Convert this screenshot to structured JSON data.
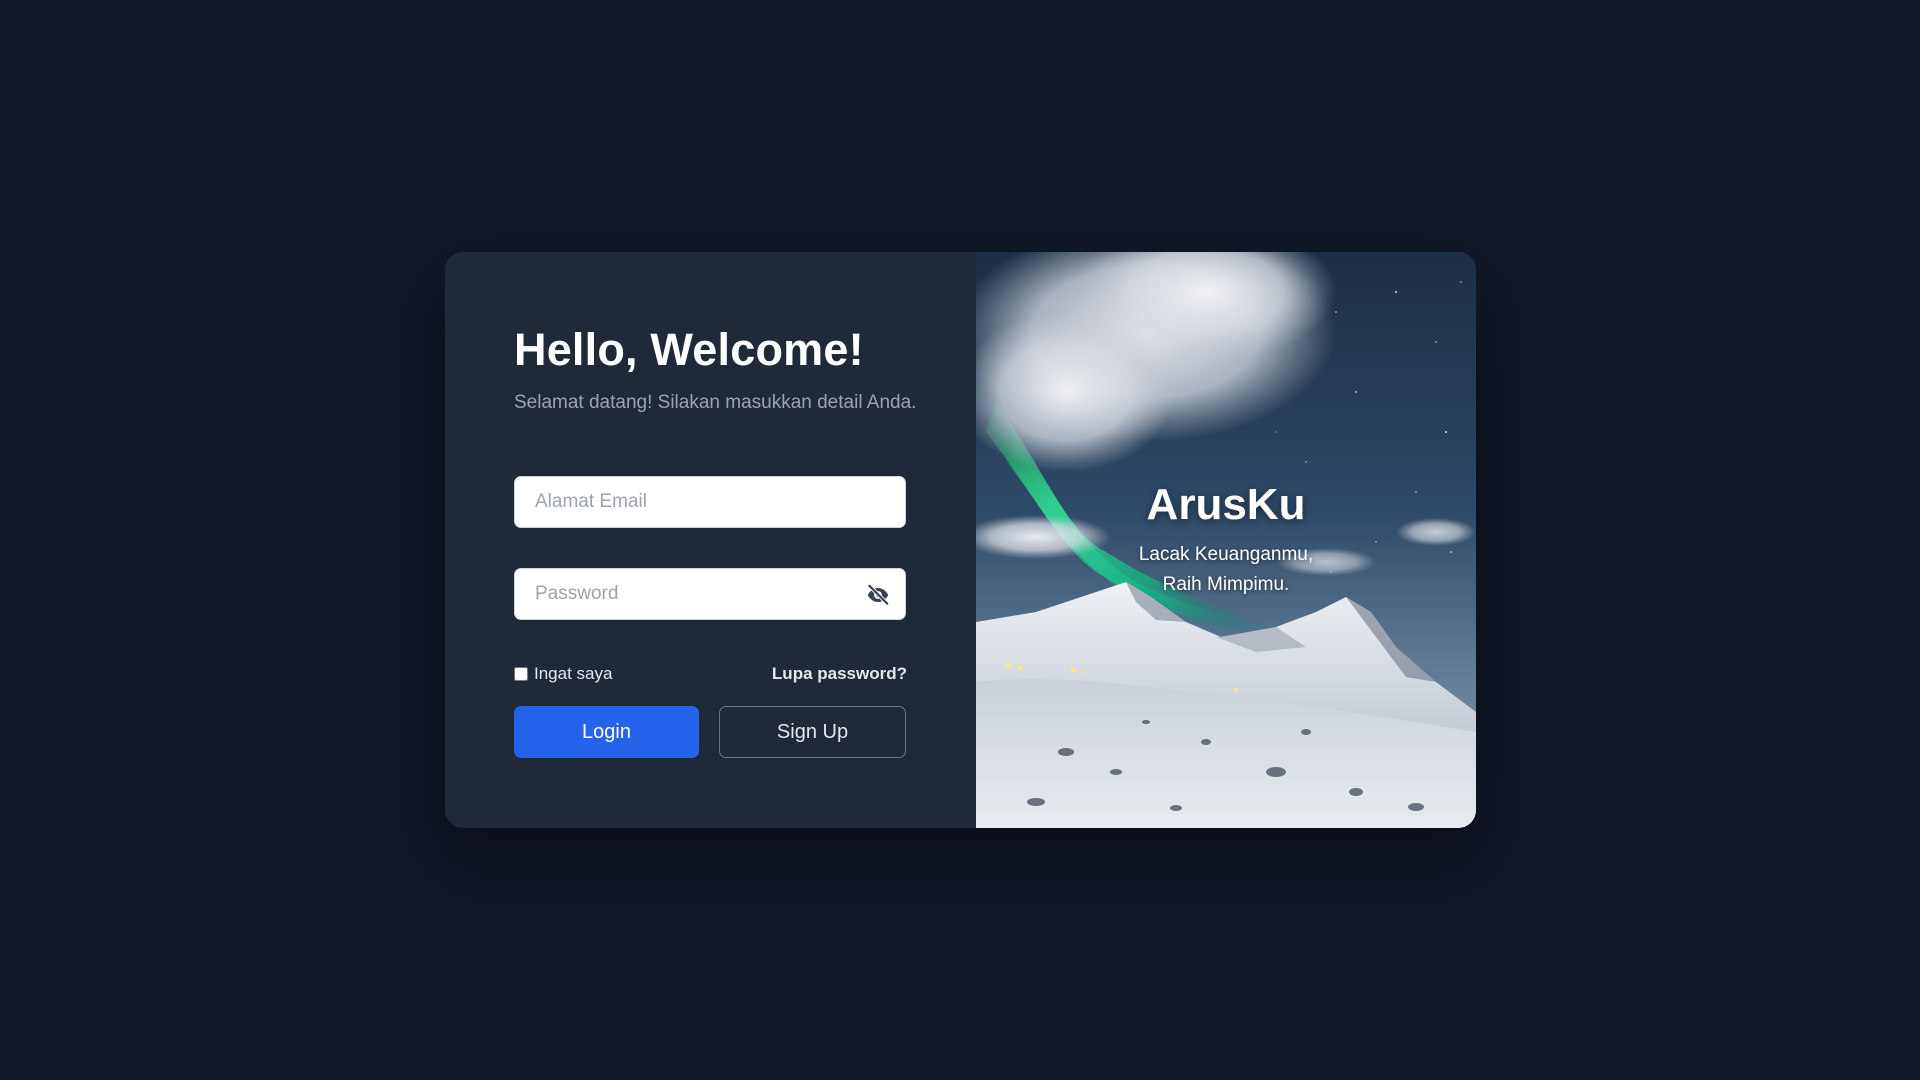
{
  "login": {
    "title": "Hello, Welcome!",
    "subtitle": "Selamat datang! Silakan masukkan detail Anda.",
    "email_placeholder": "Alamat Email",
    "email_value": "",
    "password_placeholder": "Password",
    "password_value": "",
    "remember_label": "Ingat saya",
    "remember_checked": false,
    "forgot_label": "Lupa password?",
    "login_label": "Login",
    "signup_label": "Sign Up"
  },
  "hero": {
    "brand": "ArusKu",
    "tagline_line1": "Lacak Keuanganmu,",
    "tagline_line2": "Raih Mimpimu.",
    "image_subject": "aurora over snowy mountains"
  },
  "icons": {
    "password_toggle": "eye-slash-icon"
  },
  "colors": {
    "page_background": "#111827",
    "card_background": "#1f2937",
    "primary_button": "#2563eb",
    "muted_text": "#9ca3af",
    "aurora": "#22c55e"
  }
}
